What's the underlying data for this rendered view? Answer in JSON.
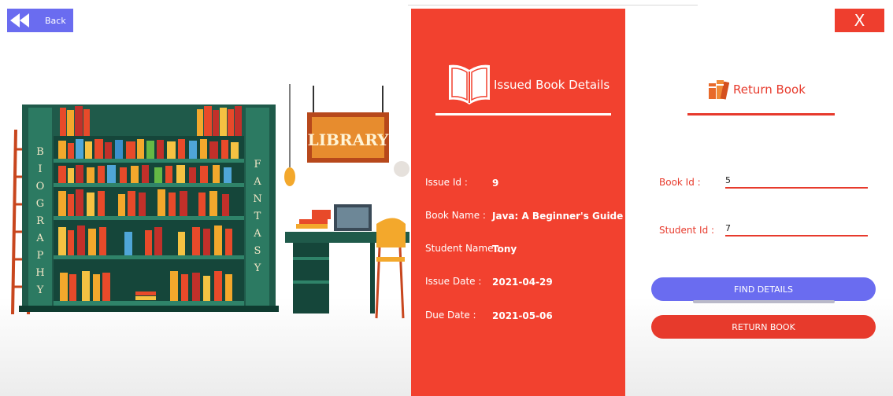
{
  "header": {
    "back_label": "Back",
    "close_label": "X"
  },
  "illustration": {
    "sign_text": "LIBRARY",
    "shelf_left_text": "BIOGRAPHY",
    "shelf_right_text": "FANTASY"
  },
  "issued_panel": {
    "title": "Issued Book Details",
    "rows": [
      {
        "label": "Issue Id :",
        "value": "9"
      },
      {
        "label": "Book Name :",
        "value": "Java: A Beginner's Guide"
      },
      {
        "label": "Student Name :",
        "value": "Tony"
      },
      {
        "label": "Issue Date :",
        "value": "2021-04-29"
      },
      {
        "label": "Due Date :",
        "value": "2021-05-06"
      }
    ]
  },
  "return_form": {
    "title": "Return Book",
    "book_id_label": "Book Id :",
    "book_id_value": "5",
    "student_id_label": "Student Id :",
    "student_id_value": "7",
    "find_label": "FIND DETAILS",
    "return_label": "RETURN BOOK"
  },
  "colors": {
    "accent_red": "#f2412f",
    "accent_blue": "#6a6cf0"
  }
}
